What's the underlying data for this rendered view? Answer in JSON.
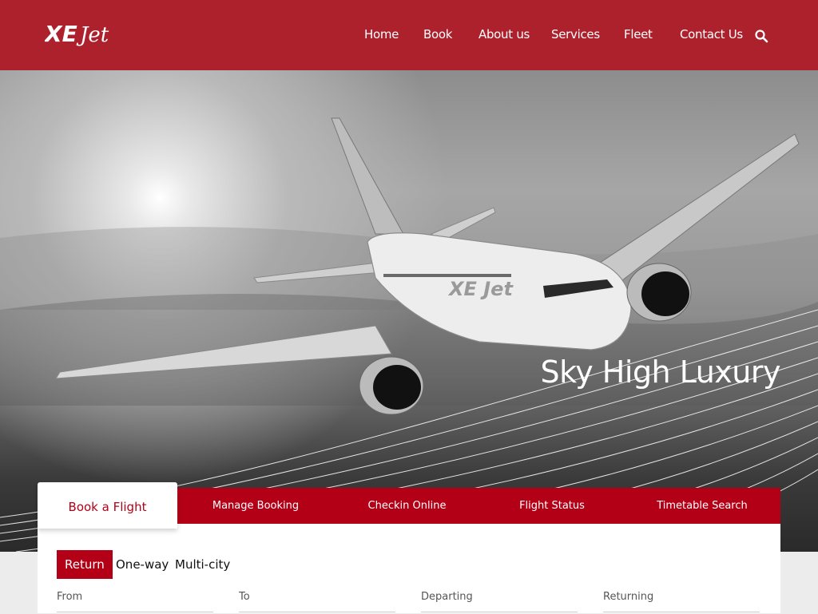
{
  "header": {
    "logo_text": "XE Jet",
    "nav": [
      "Home",
      "Book",
      "About us",
      "Services",
      "Fleet",
      "Contact Us"
    ]
  },
  "hero": {
    "tagline": "Sky High Luxury",
    "aircraft_livery": "XE Jet"
  },
  "booking": {
    "tabs": [
      "Book a Flight",
      "Manage Booking",
      "Checkin Online",
      "Flight Status",
      "Timetable Search"
    ],
    "trip_types": [
      "Return",
      "One-way",
      "Multi-city"
    ],
    "fields": [
      "From",
      "To",
      "Departing",
      "Returning"
    ]
  },
  "colors": {
    "brand_red": "#ad212d",
    "tab_red": "#b30016"
  }
}
